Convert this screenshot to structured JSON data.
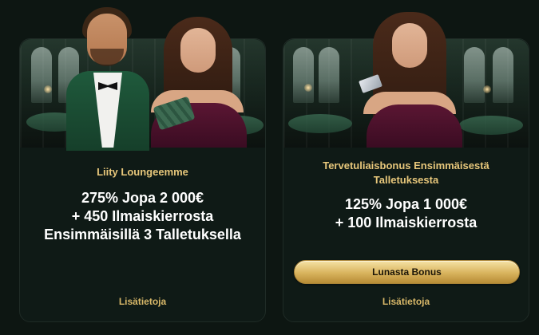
{
  "offers": [
    {
      "subtitle": "Liity Loungeemme",
      "headline_lines": [
        "275% Jopa 2 000€",
        "+ 450 Ilmaiskierrosta",
        "Ensimmäisillä 3 Talletuksella"
      ],
      "more_label": "Lisätietoja"
    },
    {
      "subtitle_lines": [
        "Tervetuliaisbonus Ensimmäisestä",
        "Talletuksesta"
      ],
      "headline_lines": [
        "125% Jopa 1 000€",
        "+ 100 Ilmaiskierrosta"
      ],
      "button_label": "Lunasta Bonus",
      "more_label": "Lisätietoja"
    }
  ],
  "colors": {
    "background": "#0d1612",
    "card": "#0f1a16",
    "accent_gold": "#e7c77b",
    "button_gold": "#d8b35d"
  }
}
